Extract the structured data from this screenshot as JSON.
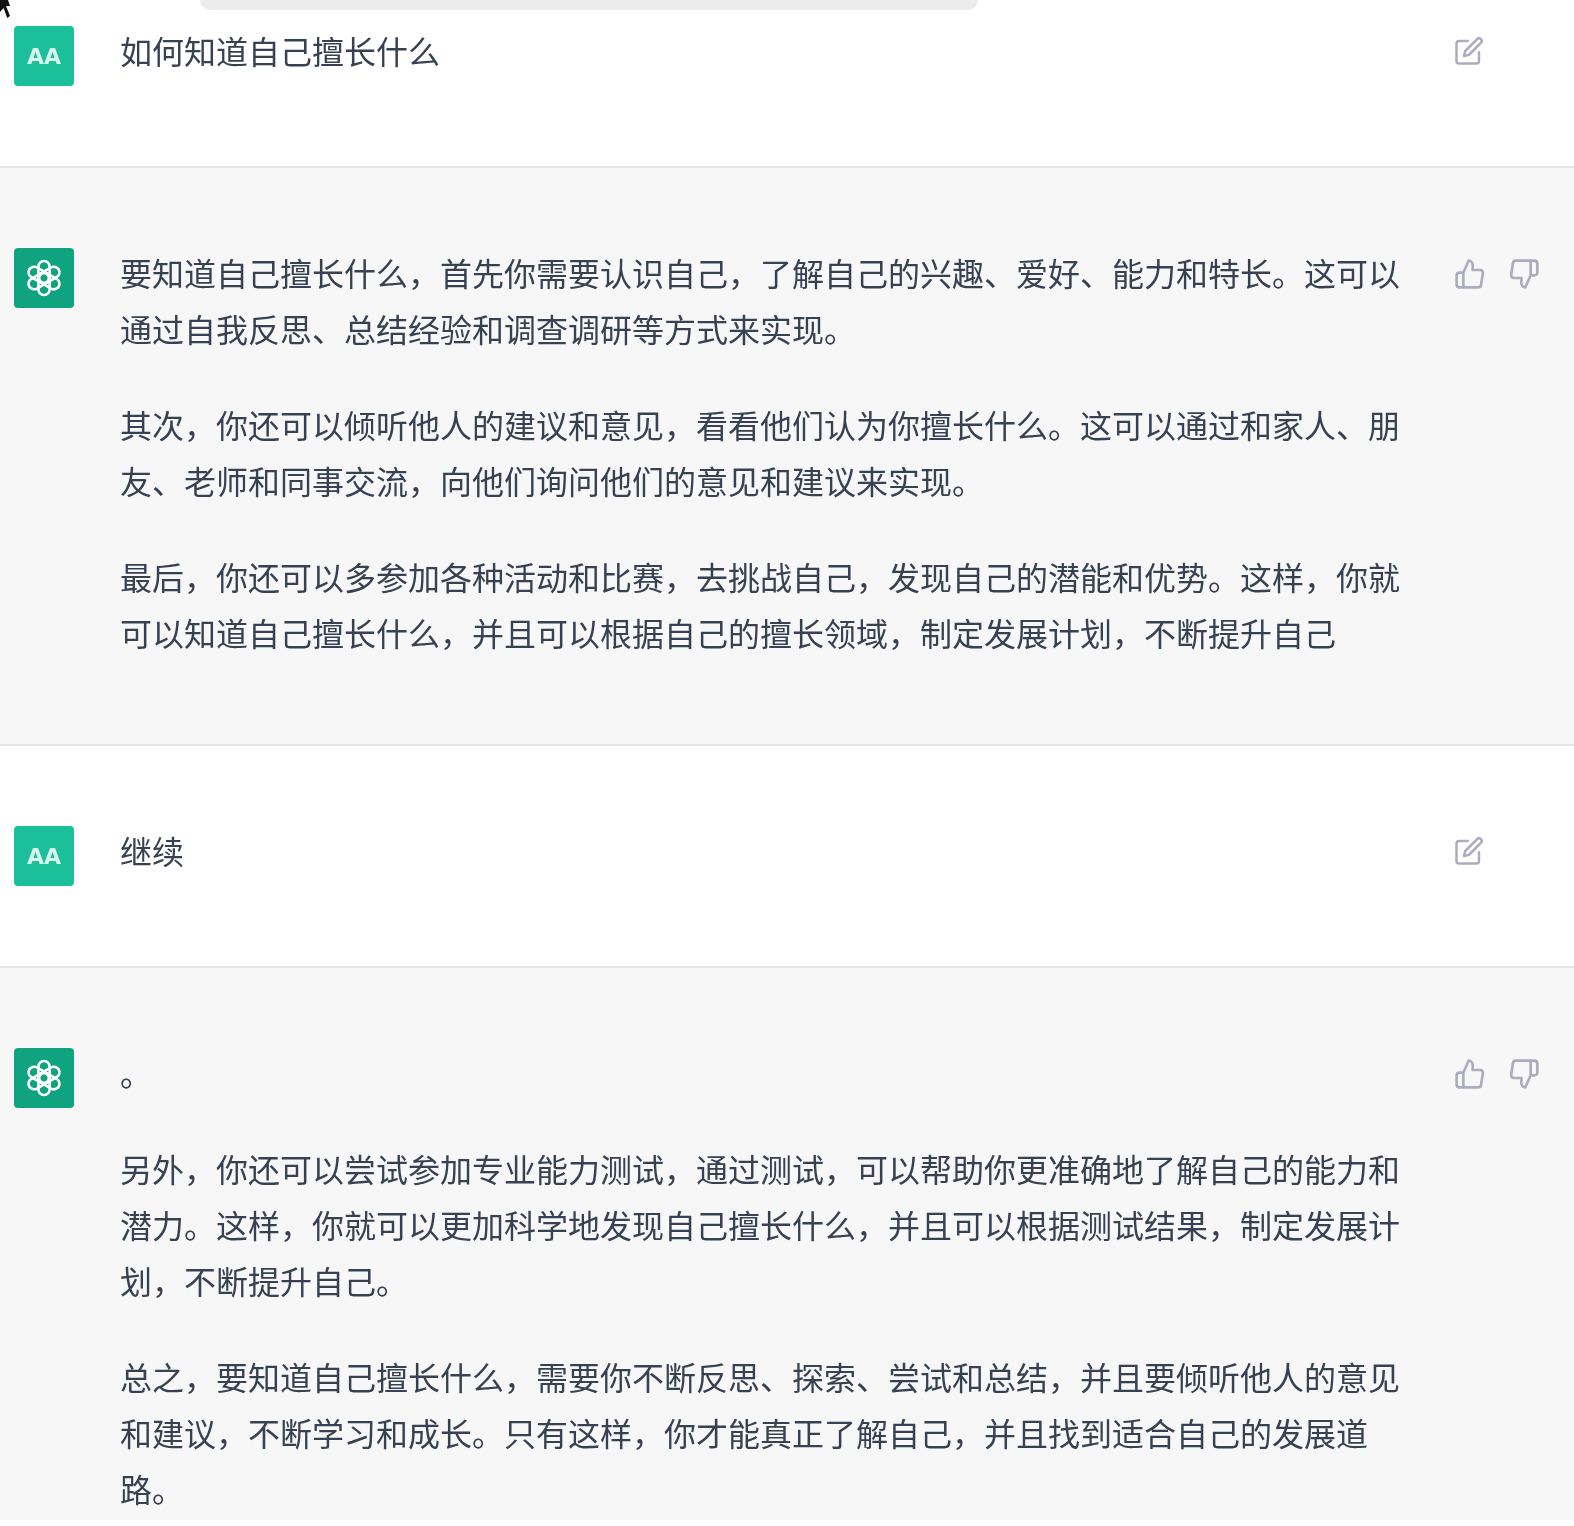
{
  "messages": [
    {
      "kind": "user",
      "avatar": "AA",
      "paragraphs": [
        "如何知道自己擅长什么"
      ]
    },
    {
      "kind": "assistant",
      "paragraphs": [
        "要知道自己擅长什么，首先你需要认识自己，了解自己的兴趣、爱好、能力和特长。这可以通过自我反思、总结经验和调查调研等方式来实现。",
        "其次，你还可以倾听他人的建议和意见，看看他们认为你擅长什么。这可以通过和家人、朋友、老师和同事交流，向他们询问他们的意见和建议来实现。",
        "最后，你还可以多参加各种活动和比赛，去挑战自己，发现自己的潜能和优势。这样，你就可以知道自己擅长什么，并且可以根据自己的擅长领域，制定发展计划，不断提升自己"
      ]
    },
    {
      "kind": "user",
      "avatar": "AA",
      "paragraphs": [
        "继续"
      ]
    },
    {
      "kind": "assistant",
      "paragraphs": [
        "。",
        "另外，你还可以尝试参加专业能力测试，通过测试，可以帮助你更准确地了解自己的能力和潜力。这样，你就可以更加科学地发现自己擅长什么，并且可以根据测试结果，制定发展计划，不断提升自己。",
        "总之，要知道自己擅长什么，需要你不断反思、探索、尝试和总结，并且要倾听他人的意见和建议，不断学习和成长。只有这样，你才能真正了解自己，并且找到适合自己的发展道路。"
      ]
    }
  ]
}
